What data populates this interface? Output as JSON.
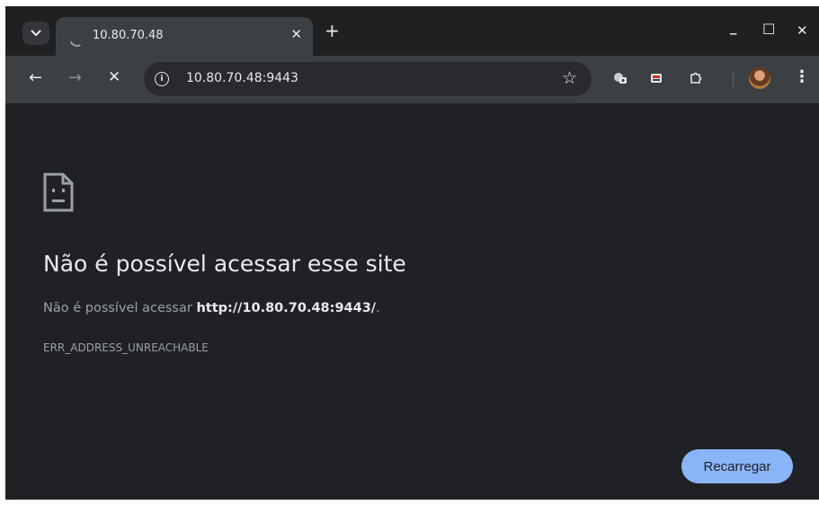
{
  "tab": {
    "title": "10.80.70.48",
    "close_glyph": "✕",
    "new_tab_glyph": "+"
  },
  "window_controls": {
    "minimize_glyph": "_",
    "maximize_glyph": "☐",
    "close_glyph": "✕"
  },
  "toolbar": {
    "back_glyph": "←",
    "forward_glyph": "→",
    "stop_glyph": "✕",
    "url": "10.80.70.48:9443",
    "star_glyph": "☆",
    "menu_glyph": "⋮"
  },
  "error": {
    "heading": "Não é possível acessar esse site",
    "message_prefix": "Não é possível acessar ",
    "message_url": "http://10.80.70.48:9443/",
    "message_suffix": ".",
    "code": "ERR_ADDRESS_UNREACHABLE",
    "reload_label": "Recarregar"
  },
  "colors": {
    "page_background": "#202124",
    "toolbar": "#3c4043",
    "tabstrip": "#1f2021",
    "accent_button": "#8ab4f8"
  }
}
